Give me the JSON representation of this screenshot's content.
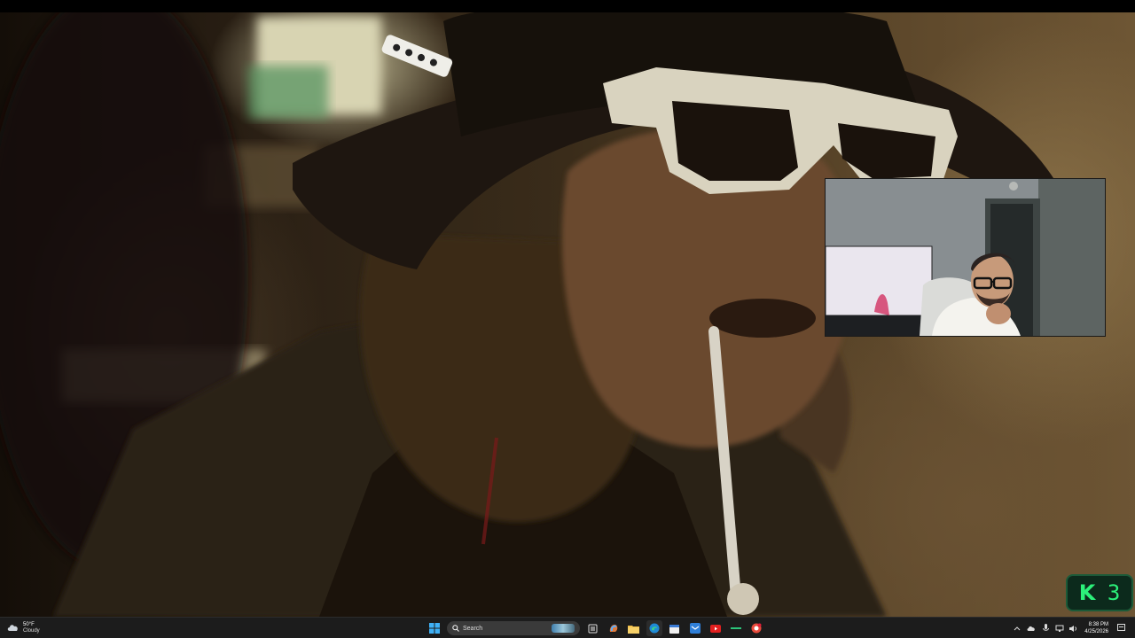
{
  "video": {
    "description_icon": "video-frame"
  },
  "webcam": {
    "icon": "webcam-overlay"
  },
  "badge": {
    "letter": "K",
    "number": "3",
    "color": "#2cf07a"
  },
  "taskbar": {
    "weather": {
      "temp": "50°F",
      "condition": "Cloudy",
      "icon": "cloud-icon"
    },
    "search_label": "Search",
    "apps": [
      "start-icon",
      "task-view-icon",
      "copilot-icon",
      "file-explorer-icon",
      "edge-icon",
      "calendar-icon",
      "mail-icon",
      "youtube-icon",
      "terminal-icon",
      "chrome-icon"
    ],
    "clock": {
      "time": "8:38 PM",
      "date": "4/25/2026"
    }
  }
}
